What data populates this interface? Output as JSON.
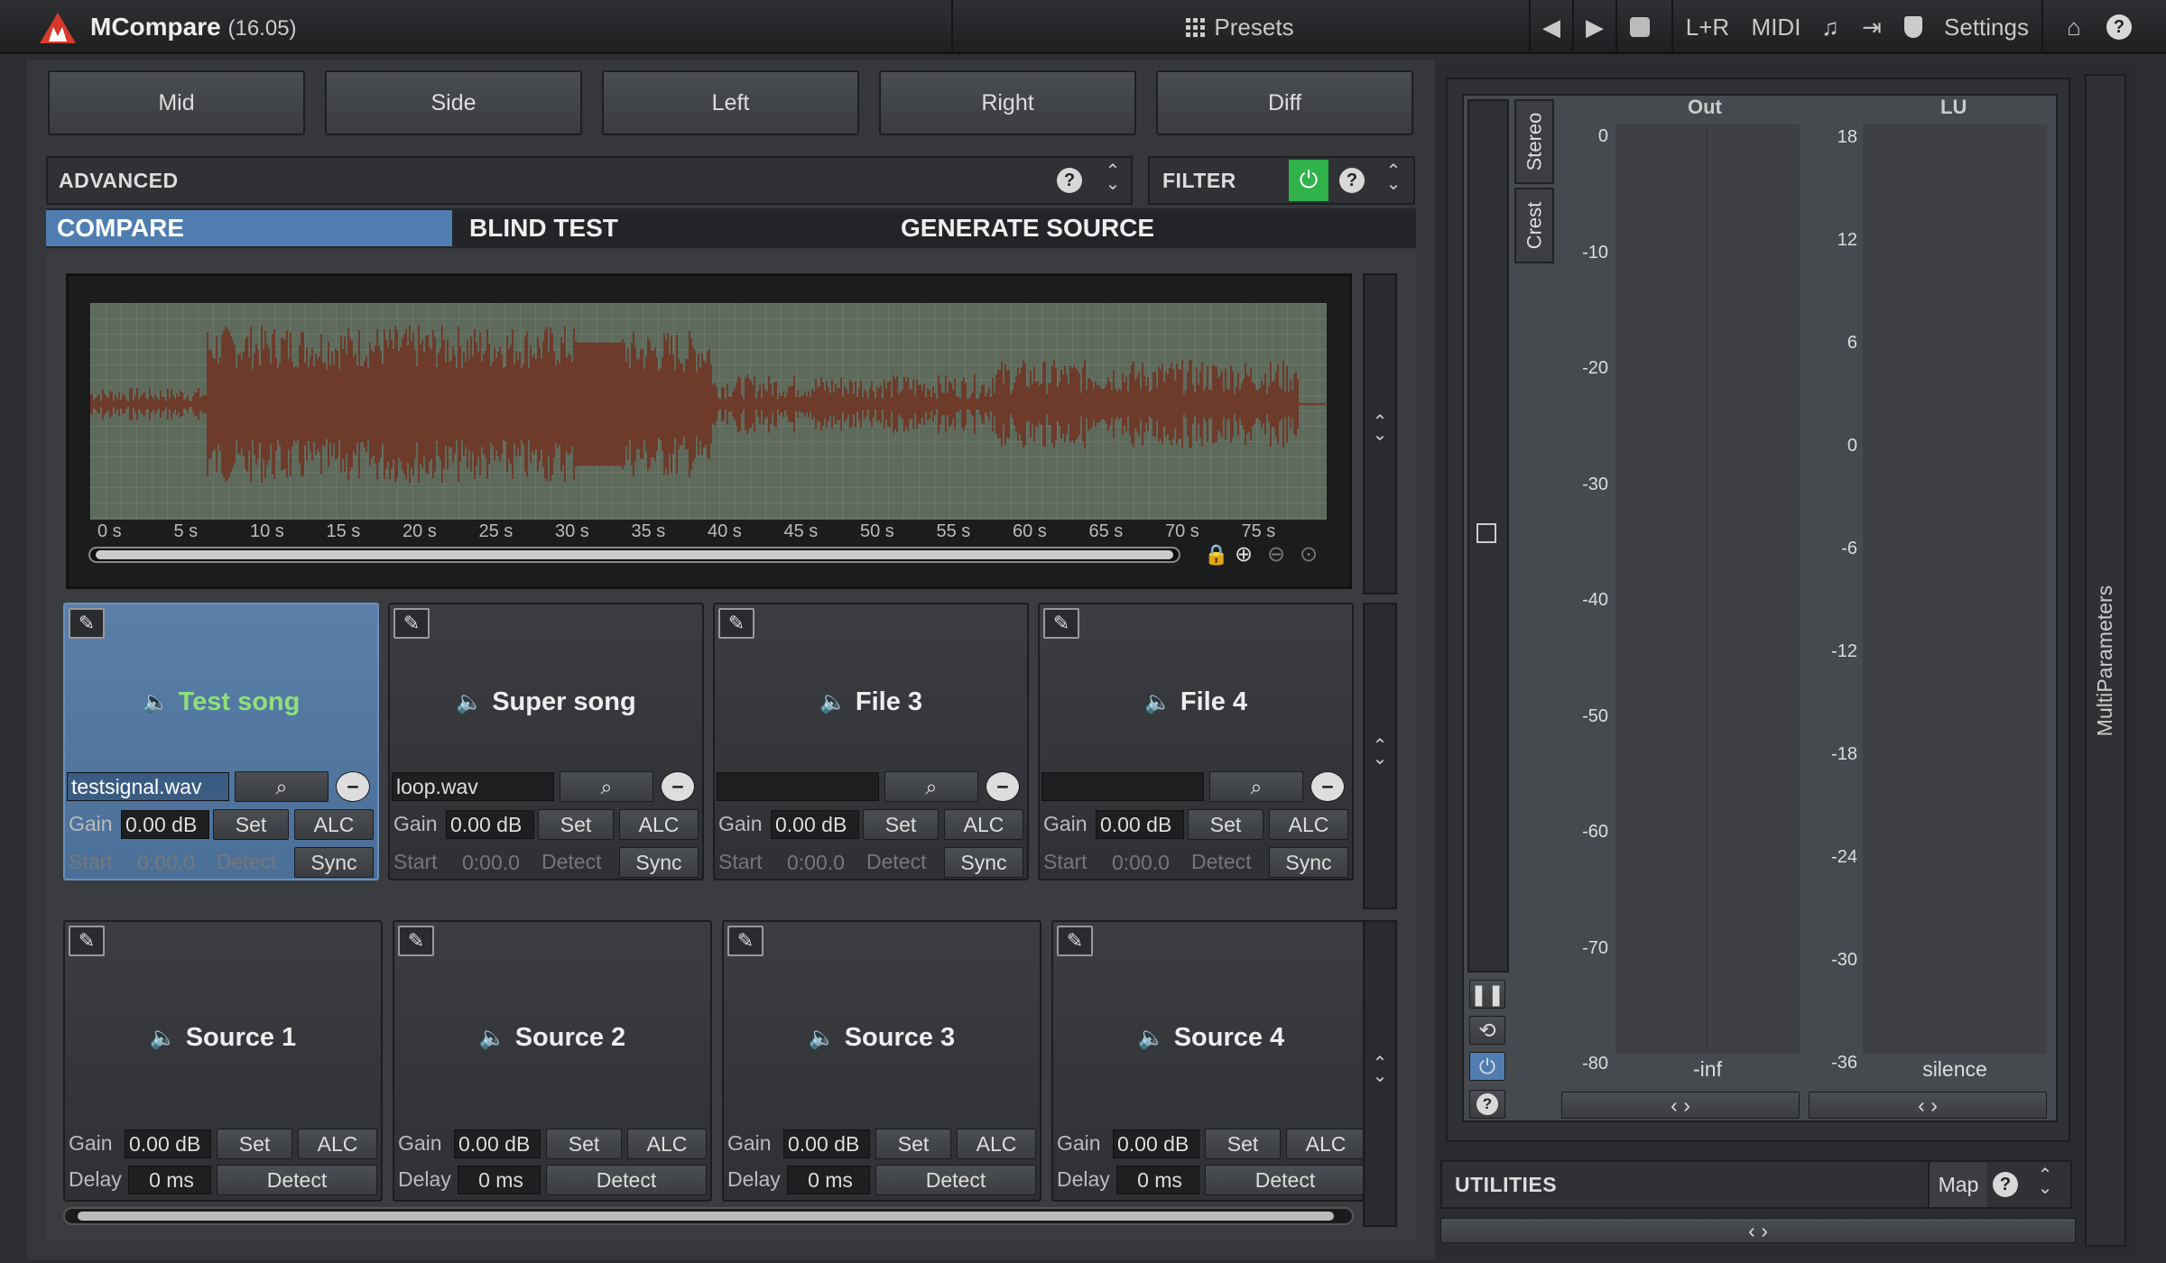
{
  "app": {
    "name": "MCompare",
    "version": "(16.05)"
  },
  "toolbar": {
    "presets": "Presets",
    "lr": "L+R",
    "midi": "MIDI",
    "settings": "Settings"
  },
  "modes": [
    "Mid",
    "Side",
    "Left",
    "Right",
    "Diff"
  ],
  "advanced": {
    "label": "ADVANCED"
  },
  "filter": {
    "label": "FILTER",
    "power_color": "#2fb34a"
  },
  "tabs": {
    "compare": "COMPARE",
    "blind": "BLIND TEST",
    "generate": "GENERATE SOURCE"
  },
  "waveform": {
    "ticks": [
      "0 s",
      "5 s",
      "10 s",
      "15 s",
      "20 s",
      "25 s",
      "30 s",
      "35 s",
      "40 s",
      "45 s",
      "50 s",
      "55 s",
      "60 s",
      "65 s",
      "70 s",
      "75 s"
    ],
    "color": "#6e3a2a",
    "bg": "#5e6b5c"
  },
  "files": [
    {
      "title": "Test song",
      "file": "testsignal.wav",
      "gain": "0.00 dB",
      "start": "0:00.0"
    },
    {
      "title": "Super song",
      "file": "loop.wav",
      "gain": "0.00 dB",
      "start": "0:00.0"
    },
    {
      "title": "File 3",
      "file": "",
      "gain": "0.00 dB",
      "start": "0:00.0"
    },
    {
      "title": "File 4",
      "file": "",
      "gain": "0.00 dB",
      "start": "0:00.0"
    }
  ],
  "sources": [
    {
      "title": "Source 1",
      "gain": "0.00 dB",
      "delay": "0 ms"
    },
    {
      "title": "Source 2",
      "gain": "0.00 dB",
      "delay": "0 ms"
    },
    {
      "title": "Source 3",
      "gain": "0.00 dB",
      "delay": "0 ms"
    },
    {
      "title": "Source 4",
      "gain": "0.00 dB",
      "delay": "0 ms"
    }
  ],
  "labels": {
    "gain": "Gain",
    "set": "Set",
    "alc": "ALC",
    "start": "Start",
    "detect": "Detect",
    "sync": "Sync",
    "delay": "Delay"
  },
  "meter": {
    "side_tabs": [
      "Stereo",
      "Crest"
    ],
    "out_label": "Out",
    "lu_label": "LU",
    "out_ticks": [
      "0",
      "-10",
      "-20",
      "-30",
      "-40",
      "-50",
      "-60",
      "-70",
      "-80"
    ],
    "lu_ticks": [
      "18",
      "12",
      "6",
      "0",
      "-6",
      "-12",
      "-18",
      "-24",
      "-30",
      "-36"
    ],
    "out_value": "-inf",
    "lu_value": "silence"
  },
  "utilities": {
    "label": "UTILITIES",
    "map": "Map"
  },
  "multiparams": "MultiParameters"
}
